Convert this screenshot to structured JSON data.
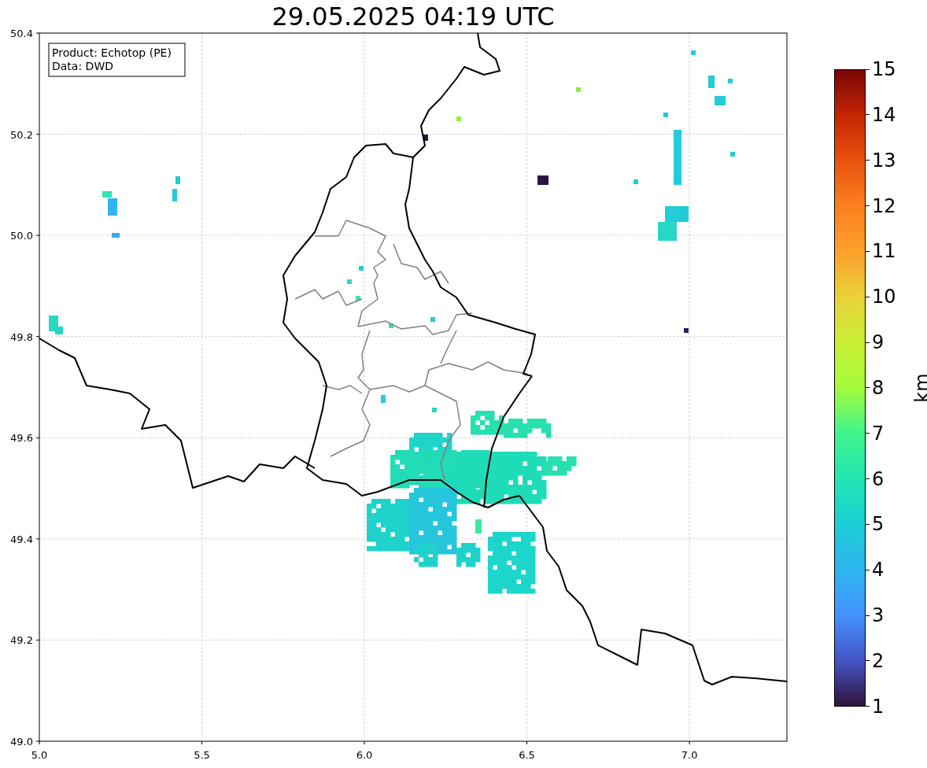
{
  "title": "29.05.2025 04:19 UTC",
  "legend": [
    "Product: Echotop (PE)",
    "Data: DWD"
  ],
  "x_ticks": [
    "5.0",
    "5.5",
    "6.0",
    "6.5",
    "7.0"
  ],
  "y_ticks": [
    "50.4",
    "50.2",
    "50.0",
    "49.8",
    "49.6",
    "49.4",
    "49.2",
    "49.0"
  ],
  "colorbar": {
    "ticks": [
      "15",
      "14",
      "13",
      "12",
      "11",
      "10",
      "9",
      "8",
      "7",
      "6",
      "5",
      "4",
      "3",
      "2",
      "1"
    ],
    "label": "km"
  }
}
